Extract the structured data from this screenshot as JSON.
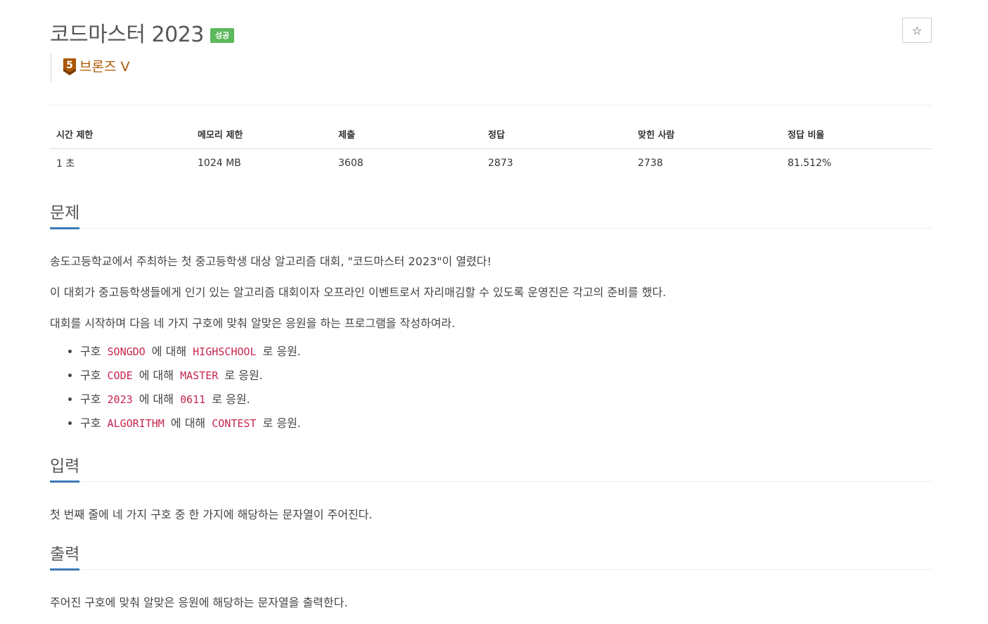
{
  "header": {
    "title": "코드마스터 2023",
    "status_badge": "성공",
    "star_icon": "☆"
  },
  "tier": {
    "icon_number": "5",
    "label": "브론즈 V",
    "color": "#ad5600"
  },
  "info_table": {
    "headers": [
      "시간 제한",
      "메모리 제한",
      "제출",
      "정답",
      "맞힌 사람",
      "정답 비율"
    ],
    "values": [
      "1 초",
      "1024 MB",
      "3608",
      "2873",
      "2738",
      "81.512%"
    ]
  },
  "sections": {
    "problem": {
      "heading": "문제",
      "paragraphs": [
        "송도고등학교에서 주최하는 첫 중고등학생 대상 알고리즘 대회, \"코드마스터 2023\"이 열렸다!",
        "이 대회가 중고등학생들에게 인기 있는 알고리즘 대회이자 오프라인 이벤트로서 자리매김할 수 있도록 운영진은 각고의 준비를 했다.",
        "대회를 시작하며 다음 네 가지 구호에 맞춰 알맞은 응원을 하는 프로그램을 작성하여라."
      ],
      "cases": [
        {
          "pre": "구호 ",
          "code1": "SONGDO",
          "mid": " 에 대해 ",
          "code2": "HIGHSCHOOL",
          "post": " 로 응원."
        },
        {
          "pre": "구호 ",
          "code1": "CODE",
          "mid": " 에 대해 ",
          "code2": "MASTER",
          "post": " 로 응원."
        },
        {
          "pre": "구호 ",
          "code1": "2023",
          "mid": " 에 대해 ",
          "code2": "0611",
          "post": " 로 응원."
        },
        {
          "pre": "구호 ",
          "code1": "ALGORITHM",
          "mid": " 에 대해 ",
          "code2": "CONTEST",
          "post": " 로 응원."
        }
      ]
    },
    "input": {
      "heading": "입력",
      "text": "첫 번째 줄에 네 가지 구호 중 한 가지에 해당하는 문자열이 주어진다."
    },
    "output": {
      "heading": "출력",
      "text": "주어진 구호에 맞춰 알맞은 응원에 해당하는 문자열을 출력한다."
    }
  }
}
